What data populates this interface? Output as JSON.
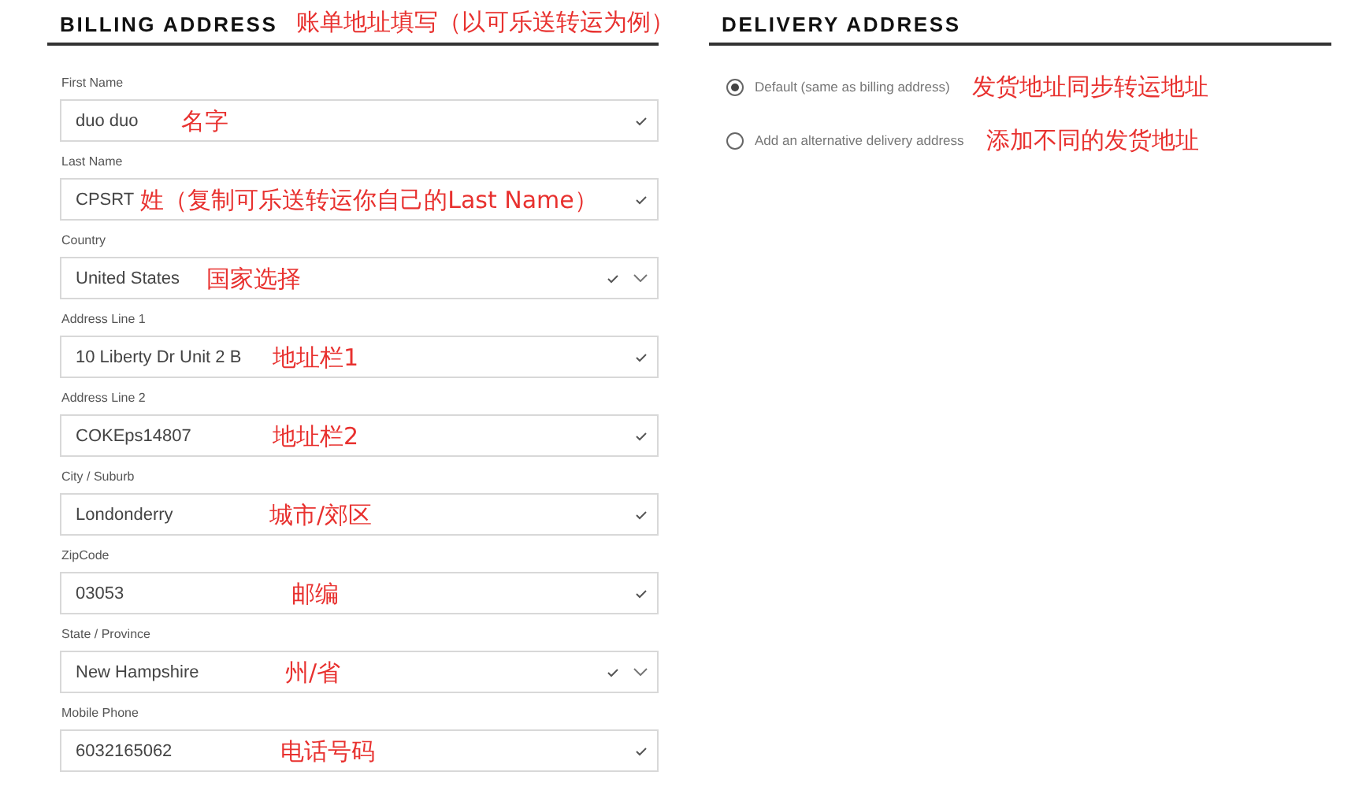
{
  "billing": {
    "title": "BILLING ADDRESS",
    "annotation": "账单地址填写（以可乐送转运为例）",
    "fields": [
      {
        "label": "First Name",
        "value": "duo duo",
        "kind": "text",
        "valid": true,
        "annotation": "名字"
      },
      {
        "label": "Last Name",
        "value": "CPSRT",
        "kind": "text",
        "valid": true,
        "annotation": "姓（复制可乐送转运你自己的Last Name）"
      },
      {
        "label": "Country",
        "value": "United States",
        "kind": "select",
        "valid": true,
        "annotation": "国家选择"
      },
      {
        "label": "Address Line 1",
        "value": "10 Liberty Dr Unit 2 B",
        "kind": "text",
        "valid": true,
        "annotation": "地址栏1"
      },
      {
        "label": "Address Line 2",
        "value": "COKEps14807",
        "kind": "text",
        "valid": true,
        "annotation": "地址栏2"
      },
      {
        "label": "City / Suburb",
        "value": "Londonderry",
        "kind": "text",
        "valid": true,
        "annotation": "城市/郊区"
      },
      {
        "label": "ZipCode",
        "value": "03053",
        "kind": "text",
        "valid": true,
        "annotation": "邮编"
      },
      {
        "label": "State / Province",
        "value": "New Hampshire",
        "kind": "select",
        "valid": true,
        "annotation": "州/省"
      },
      {
        "label": "Mobile Phone",
        "value": "6032165062",
        "kind": "text",
        "valid": true,
        "annotation": "电话号码"
      }
    ]
  },
  "delivery": {
    "title": "DELIVERY ADDRESS",
    "options": [
      {
        "label": "Default (same as billing address)",
        "selected": true,
        "annotation": "发货地址同步转运地址"
      },
      {
        "label": "Add an alternative delivery address",
        "selected": false,
        "annotation": "添加不同的发货地址"
      }
    ]
  }
}
